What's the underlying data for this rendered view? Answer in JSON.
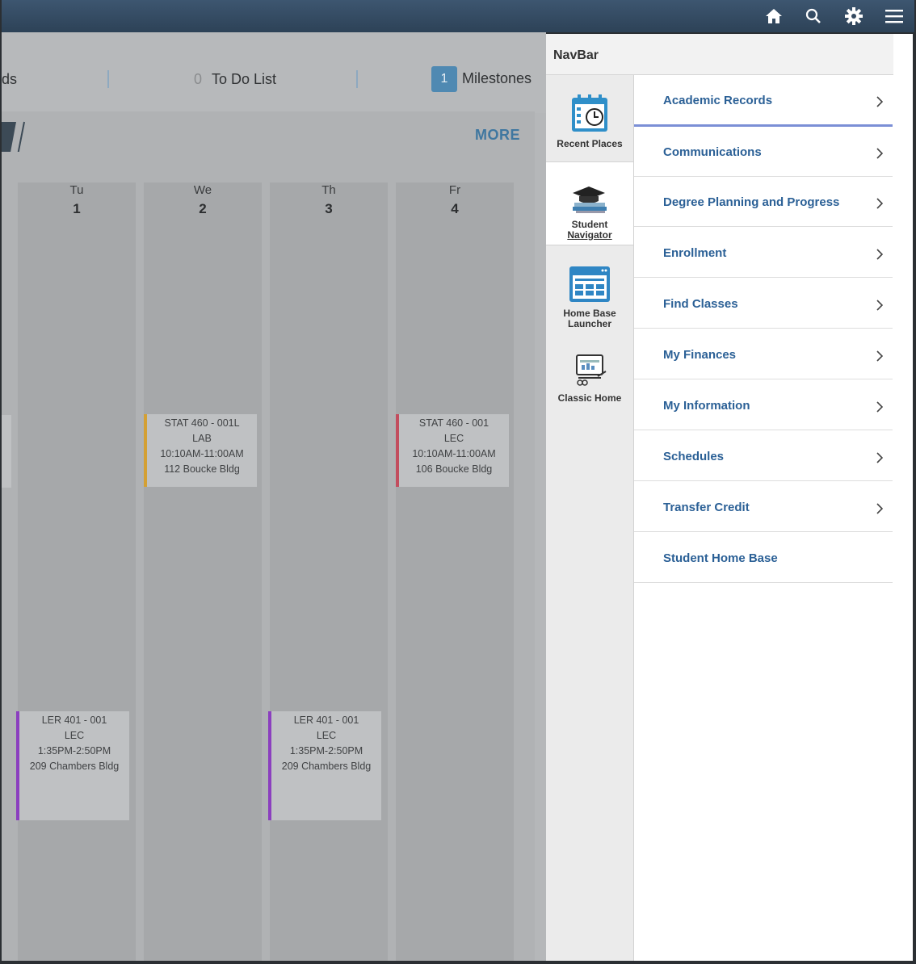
{
  "header": {
    "icons": [
      "home-icon",
      "search-icon",
      "gear-icon",
      "menu-icon"
    ]
  },
  "summary": {
    "partial_label": "ds",
    "todo_count": "0",
    "todo_label": "To Do List",
    "milestones_count": "1",
    "milestones_label": "Milestones"
  },
  "schedule": {
    "more_label": "MORE",
    "days": [
      {
        "name": "Tu",
        "num": "1"
      },
      {
        "name": "We",
        "num": "2"
      },
      {
        "name": "Th",
        "num": "3"
      },
      {
        "name": "Fr",
        "num": "4"
      }
    ],
    "events": [
      {
        "course": "STAT 460 - 001L",
        "type": "LAB",
        "time": "10:10AM-11:00AM",
        "room": "112 Boucke Bldg",
        "color": "#d4a034"
      },
      {
        "course": "STAT 460 - 001",
        "type": "LEC",
        "time": "10:10AM-11:00AM",
        "room": "106 Boucke Bldg",
        "color": "#c24d5e"
      },
      {
        "course": "LER 401 - 001",
        "type": "LEC",
        "time": "1:35PM-2:50PM",
        "room": "209 Chambers Bldg",
        "color": "#8b3fbf"
      },
      {
        "course": "LER 401 - 001",
        "type": "LEC",
        "time": "1:35PM-2:50PM",
        "room": "209 Chambers Bldg",
        "color": "#8b3fbf"
      }
    ]
  },
  "navbar": {
    "title": "NavBar",
    "tabs": [
      {
        "label1": "Recent Places",
        "label2": ""
      },
      {
        "label1": "Student",
        "label2": "Navigator"
      },
      {
        "label1": "Home Base",
        "label2": "Launcher"
      },
      {
        "label1": "Classic Home",
        "label2": ""
      }
    ],
    "menu": [
      "Academic Records",
      "Communications",
      "Degree Planning and Progress",
      "Enrollment",
      "Find Classes",
      "My Finances",
      "My Information",
      "Schedules",
      "Transfer Credit",
      "Student Home Base"
    ]
  }
}
